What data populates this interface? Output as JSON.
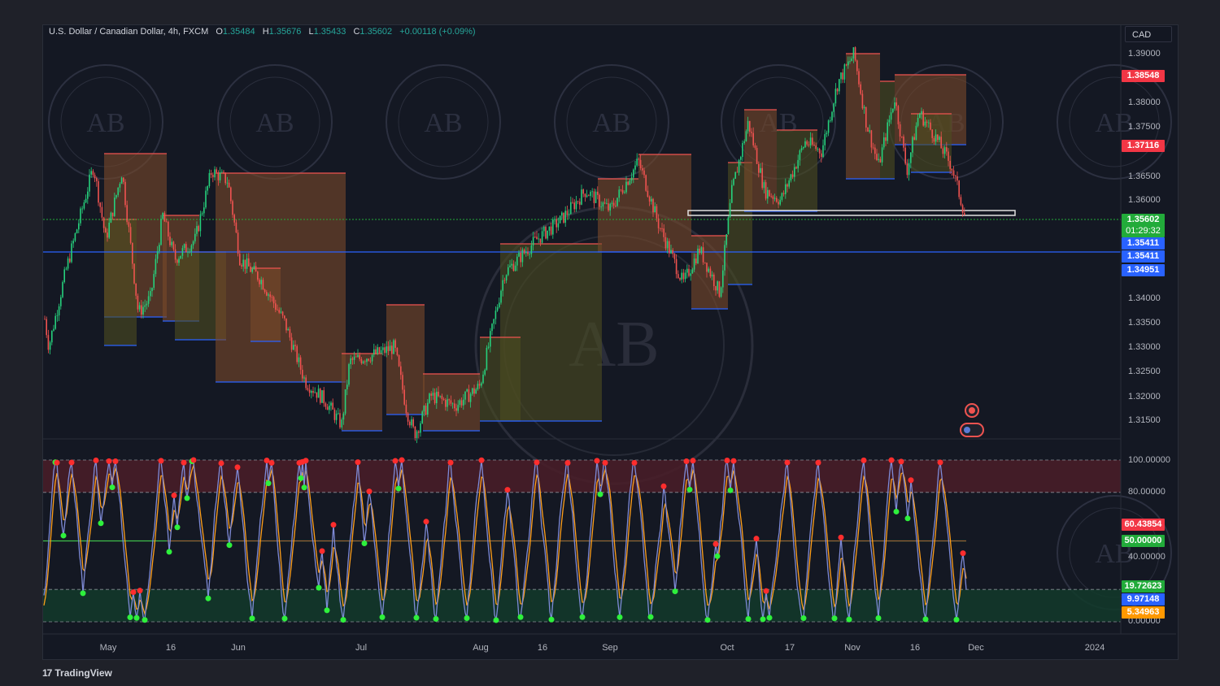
{
  "header": {
    "symbol": "U.S. Dollar / Canadian Dollar, 4h, FXCM",
    "o_label": "O",
    "o_value": "1.35484",
    "h_label": "H",
    "h_value": "1.35676",
    "l_label": "L",
    "l_value": "1.35433",
    "c_label": "C",
    "c_value": "1.35602",
    "change": "+0.00118 (+0.09%)"
  },
  "currency": "CAD",
  "price_axis": [
    "1.39000",
    "1.38000",
    "1.37500",
    "1.36500",
    "1.36000",
    "1.34000",
    "1.33500",
    "1.33000",
    "1.32500",
    "1.32000",
    "1.31500"
  ],
  "price_tags": {
    "red_top": "1.38548",
    "red_mid": "1.37116",
    "current": "1.35602",
    "countdown": "01:29:32",
    "blue1": "1.35411",
    "blue2": "1.35411",
    "blue3": "1.34951"
  },
  "osc_axis": [
    "100.00000",
    "80.00000",
    "40.00000",
    "0.00000"
  ],
  "osc_tags": {
    "red": "60.43854",
    "green_mid": "50.00000",
    "green_low": "19.72623",
    "blue": "9.97148",
    "orange": "5.34963"
  },
  "time_axis": [
    "May",
    "16",
    "Jun",
    "Jul",
    "Aug",
    "16",
    "Sep",
    "Oct",
    "17",
    "Nov",
    "16",
    "Dec",
    "2024"
  ],
  "branding": "TradingView",
  "watermark_text": "AB",
  "colors": {
    "bg": "#141823",
    "up": "#26d07c",
    "down": "#ef5350",
    "hline": "#2962ff",
    "brown_zone": "#7a4a2a",
    "olive_zone": "#4c4d1f",
    "osc_fast": "#7e8ad6",
    "osc_slow": "#ff9f1a"
  },
  "icons": [
    "canada-flag-event-icon",
    "us-flag-event-icon"
  ]
}
